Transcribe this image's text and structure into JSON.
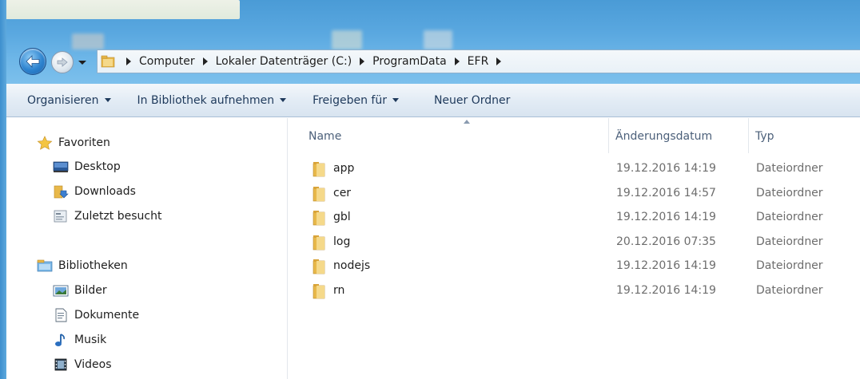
{
  "navigation": {
    "breadcrumbs": [
      "Computer",
      "Lokaler Datenträger (C:)",
      "ProgramData",
      "EFR"
    ]
  },
  "toolbar": {
    "organize": "Organisieren",
    "include_library": "In Bibliothek aufnehmen",
    "share": "Freigeben für",
    "new_folder": "Neuer Ordner"
  },
  "sidebar": {
    "favorites": {
      "label": "Favoriten",
      "items": [
        {
          "label": "Desktop",
          "icon": "desktop-icon"
        },
        {
          "label": "Downloads",
          "icon": "downloads-folder-icon"
        },
        {
          "label": "Zuletzt besucht",
          "icon": "recent-places-icon"
        }
      ]
    },
    "libraries": {
      "label": "Bibliotheken",
      "items": [
        {
          "label": "Bilder",
          "icon": "pictures-icon"
        },
        {
          "label": "Dokumente",
          "icon": "documents-icon"
        },
        {
          "label": "Musik",
          "icon": "music-note-icon"
        },
        {
          "label": "Videos",
          "icon": "film-icon"
        }
      ]
    }
  },
  "file_list": {
    "columns": {
      "name": "Name",
      "date": "Änderungsdatum",
      "type": "Typ"
    },
    "rows": [
      {
        "name": "app",
        "date": "19.12.2016 14:19",
        "type": "Dateiordner"
      },
      {
        "name": "cer",
        "date": "19.12.2016 14:57",
        "type": "Dateiordner"
      },
      {
        "name": "gbl",
        "date": "19.12.2016 14:19",
        "type": "Dateiordner"
      },
      {
        "name": "log",
        "date": "20.12.2016 07:35",
        "type": "Dateiordner"
      },
      {
        "name": "nodejs",
        "date": "19.12.2016 14:19",
        "type": "Dateiordner"
      },
      {
        "name": "rn",
        "date": "19.12.2016 14:19",
        "type": "Dateiordner"
      }
    ]
  },
  "colors": {
    "frame": "#5aa8e0",
    "folder": "#e8b84a",
    "toolbar_text": "#1e395b"
  }
}
